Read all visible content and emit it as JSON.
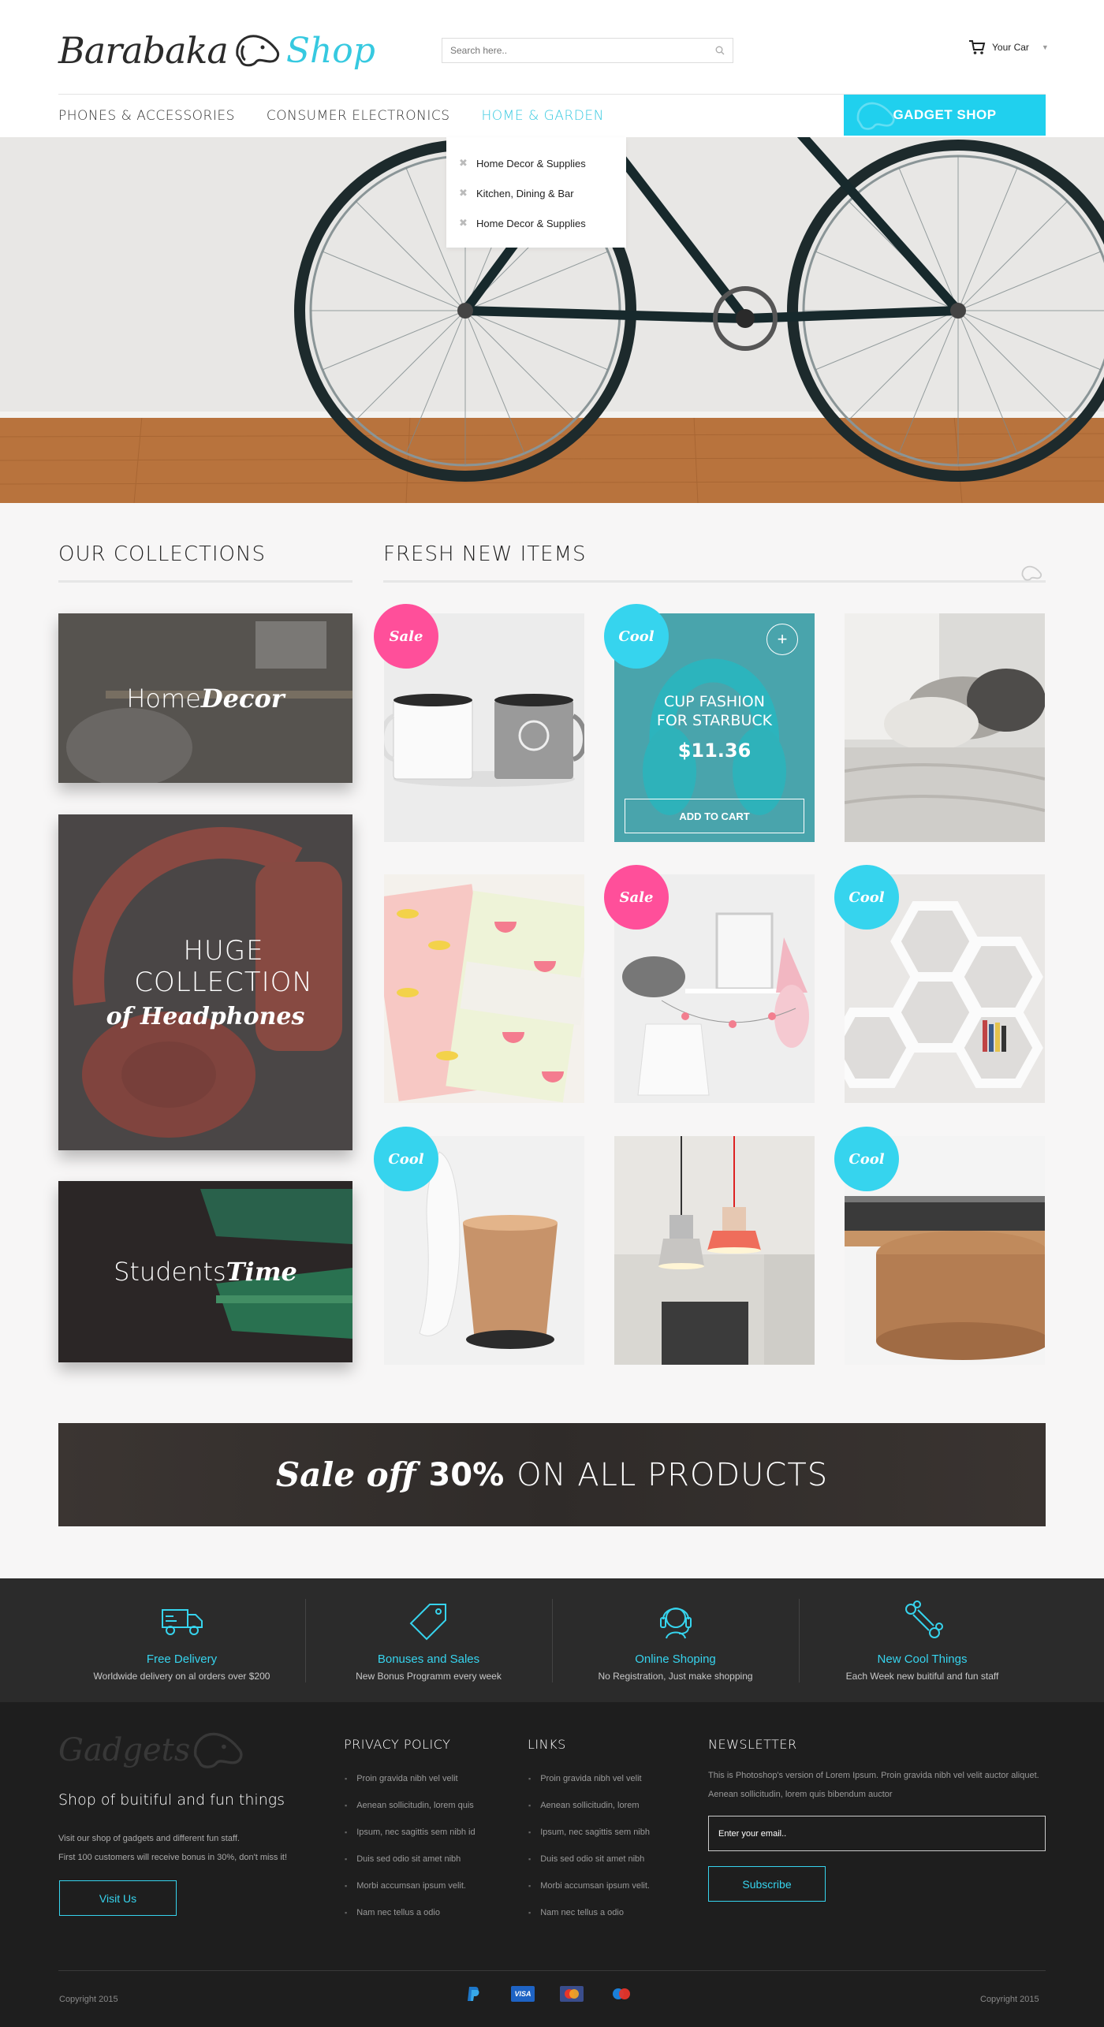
{
  "header": {
    "logo_text": "Barabaka",
    "logo_shop": "Shop",
    "search_placeholder": "Search here..",
    "cart_label": "Your Car"
  },
  "nav": {
    "items": [
      "PHONES & ACCESSORIES",
      "CONSUMER ELECTRONICS",
      "HOME & GARDEN"
    ],
    "active_index": 2,
    "gadget_button": "GADGET SHOP"
  },
  "dropdown": {
    "items": [
      "Home Decor & Supplies",
      "Kitchen, Dining & Bar",
      "Home Decor & Supplies"
    ]
  },
  "collections": {
    "title": "OUR COLLECTIONS",
    "items": [
      {
        "light": "Home",
        "bold": "Decor"
      },
      {
        "light": "HUGE COLLECTION",
        "bold": "of Headphones"
      },
      {
        "light": "Students",
        "bold": "Time"
      }
    ]
  },
  "fresh": {
    "title": "FRESH NEW ITEMS",
    "badges": [
      "Sale",
      "Cool",
      "Sale",
      "Cool",
      "Cool",
      "Cool"
    ],
    "featured": {
      "name_line1": "CUP FASHION",
      "name_line2": "FOR STARBUCK",
      "price": "$11.36",
      "button": "ADD TO CART"
    }
  },
  "sale_banner": {
    "part1": "Sale off",
    "part2": "30%",
    "part3": "ON ALL PRODUCTS"
  },
  "features": [
    {
      "icon": "truck-icon",
      "title": "Free Delivery",
      "desc": "Worldwide delivery on al orders over $200"
    },
    {
      "icon": "tag-icon",
      "title": "Bonuses and Sales",
      "desc": "New Bonus Programm every week"
    },
    {
      "icon": "headset-icon",
      "title": "Online Shoping",
      "desc": "No Registration, Just make shopping"
    },
    {
      "icon": "bone-icon",
      "title": "New Cool Things",
      "desc": "Each Week new buitiful and fun staff"
    }
  ],
  "footer": {
    "logo_text": "Gadgets",
    "tagline": "Shop of buitiful and fun things",
    "about_line1": "Visit our shop of gadgets and different fun staff.",
    "about_line2": "First 100  customers will receive bonus in 30%, don't miss it!",
    "visit_button": "Visit Us",
    "privacy": {
      "title": "PRIVACY POLICY",
      "items": [
        "Proin gravida nibh vel velit",
        "Aenean sollicitudin, lorem quis",
        "Ipsum, nec sagittis sem nibh id",
        "Duis sed odio sit amet nibh",
        "Morbi accumsan ipsum velit.",
        "Nam nec tellus a odio"
      ]
    },
    "links": {
      "title": "LINKS",
      "items": [
        "Proin gravida nibh vel velit",
        "Aenean sollicitudin, lorem",
        "Ipsum, nec sagittis sem nibh",
        "Duis sed odio sit amet nibh",
        "Morbi accumsan ipsum velit.",
        "Nam nec tellus a odio"
      ]
    },
    "newsletter": {
      "title": "NEWSLETTER",
      "text": "This is Photoshop's version  of Lorem Ipsum. Proin gravida nibh vel velit auctor aliquet. Aenean sollicitudin, lorem quis bibendum auctor",
      "email_placeholder": "Enter your email..",
      "subscribe": "Subscribe"
    },
    "copyright_left": "Copyright 2015",
    "copyright_right": "Copyright 2015",
    "payments": [
      "paypal-icon",
      "visa-icon",
      "mastercard-icon",
      "maestro-icon"
    ],
    "visa_label": "VISA"
  },
  "colors": {
    "accent": "#36d4ee",
    "sale_badge": "#ff4f9a",
    "cool_badge": "#36d4ee",
    "dark_bg": "#1e1e1e"
  }
}
